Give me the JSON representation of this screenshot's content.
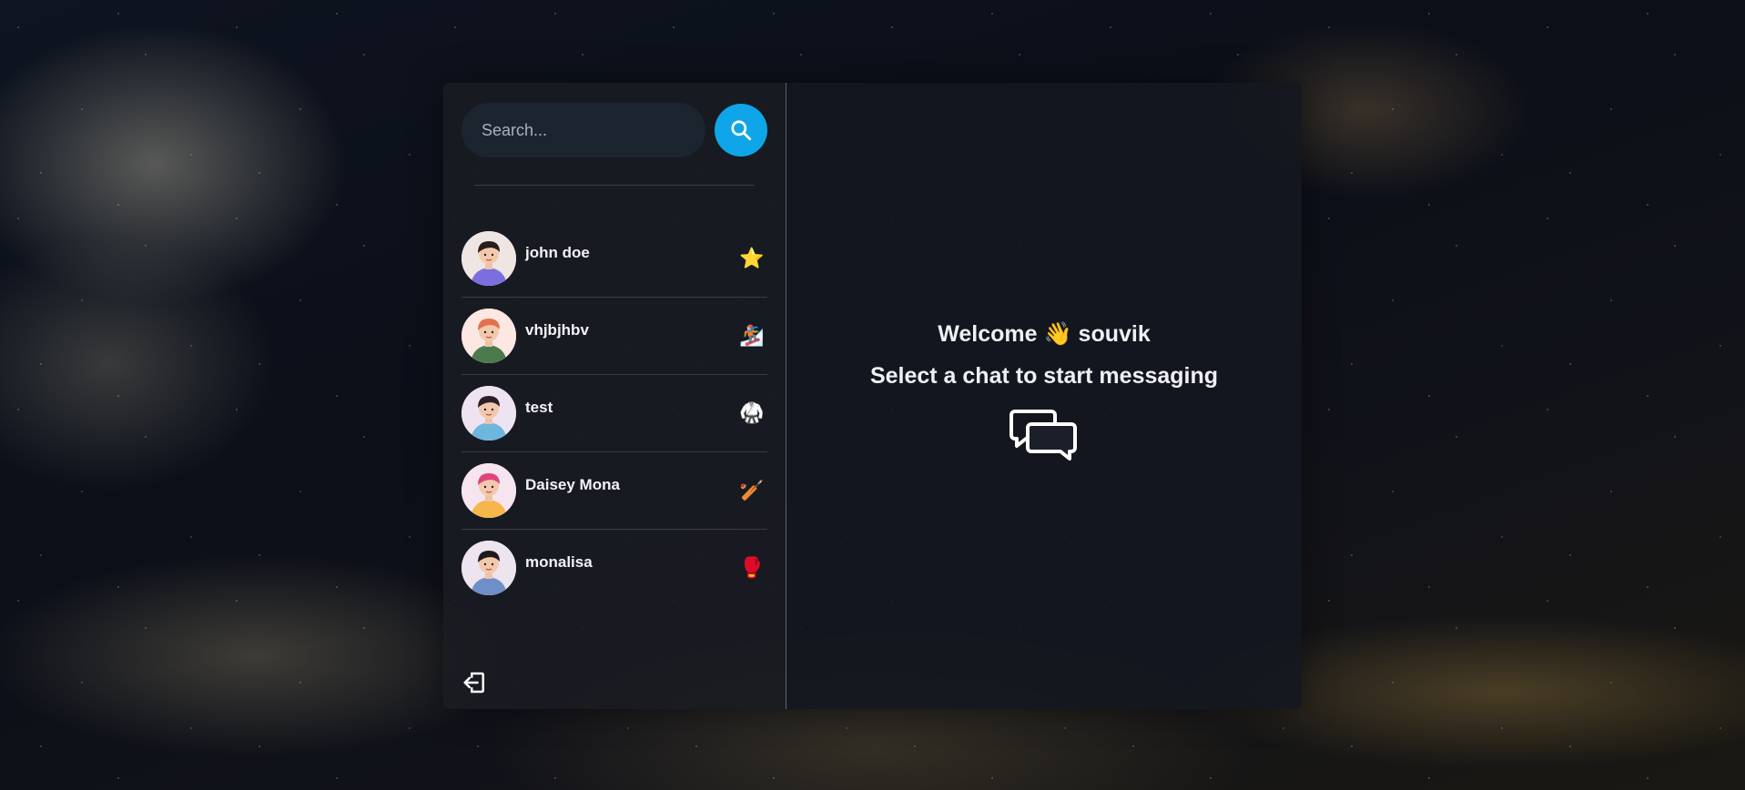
{
  "search": {
    "placeholder": "Search...",
    "button_icon": "search-icon"
  },
  "conversations": [
    {
      "name": "john doe",
      "emoji": "⭐",
      "avatar_bg": "#efe6e4",
      "shirt": "#7d6ee0",
      "hair": "#2a1d1c"
    },
    {
      "name": "vhjbjhbv",
      "emoji": "🏂",
      "avatar_bg": "#fde7e2",
      "shirt": "#4c7a4c",
      "hair": "#e2714d"
    },
    {
      "name": "test",
      "emoji": "🥋",
      "avatar_bg": "#ede3f1",
      "shirt": "#6eb6dd",
      "hair": "#2b1f27"
    },
    {
      "name": "Daisey Mona",
      "emoji": "🏏",
      "avatar_bg": "#f6e5ef",
      "shirt": "#f7b64a",
      "hair": "#e0447a"
    },
    {
      "name": "monalisa",
      "emoji": "🥊",
      "avatar_bg": "#ece4ee",
      "shirt": "#6f8fc9",
      "hair": "#1f1a1c"
    }
  ],
  "logout_icon": "logout-icon",
  "welcome": {
    "greeting": "Welcome 👋 souvik",
    "prompt": "Select a chat to start messaging",
    "icon": "chat-bubbles-icon"
  },
  "colors": {
    "accent": "#0ea5e9",
    "search_bg": "#1c2430",
    "text": "#eef0f3"
  }
}
